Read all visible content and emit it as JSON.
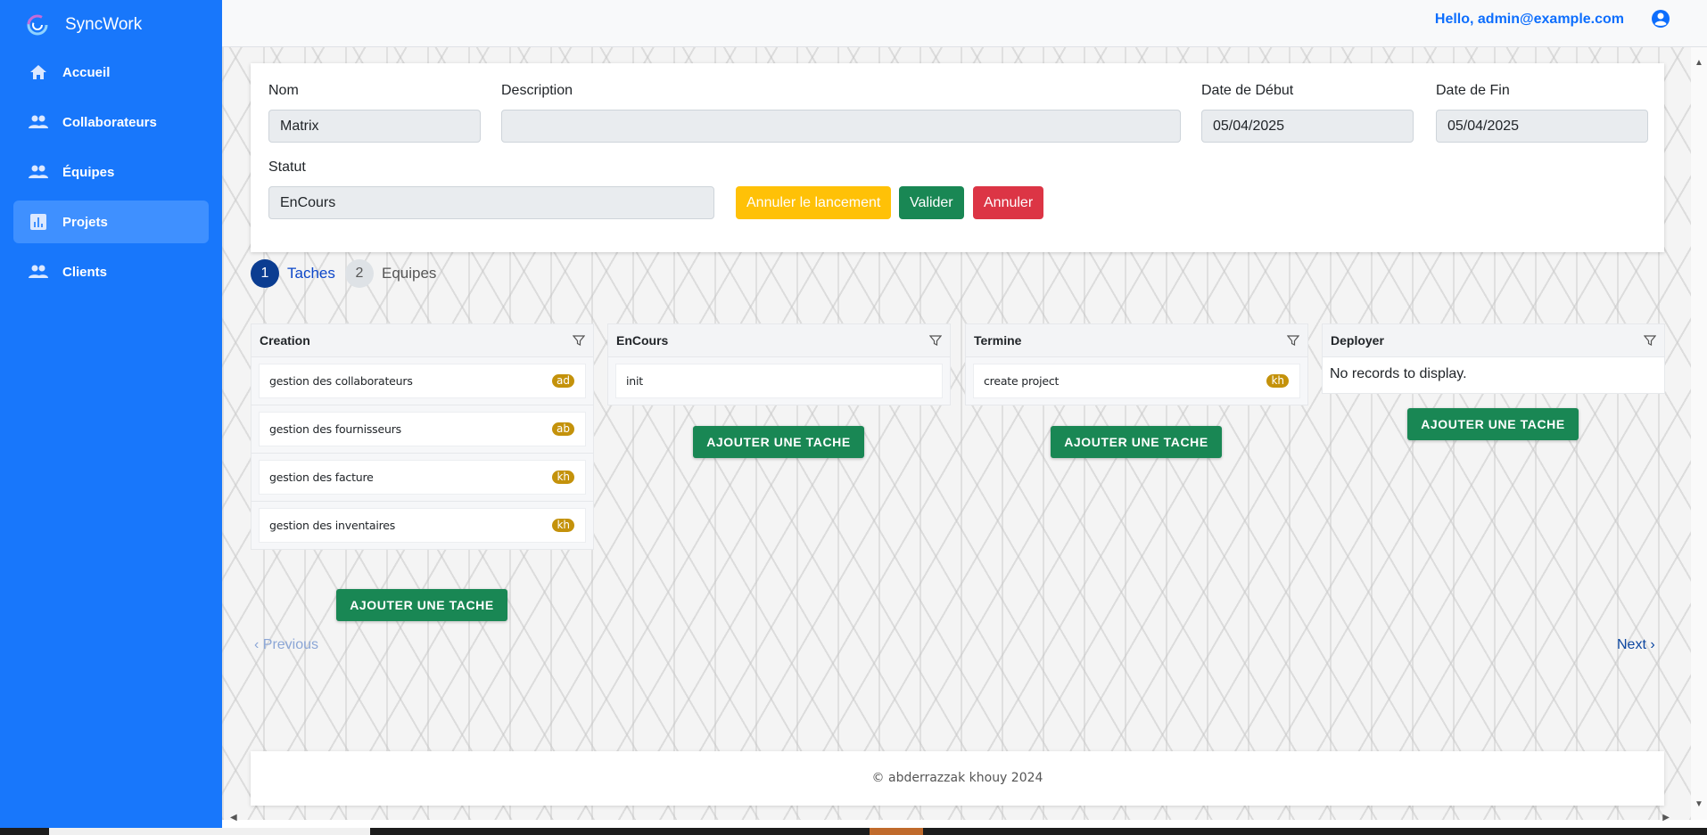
{
  "app": {
    "name": "SyncWork"
  },
  "sidebar": {
    "items": [
      {
        "label": "Accueil",
        "icon": "home-icon"
      },
      {
        "label": "Collaborateurs",
        "icon": "people-icon"
      },
      {
        "label": "Équipes",
        "icon": "people-icon"
      },
      {
        "label": "Projets",
        "icon": "chart-icon",
        "active": true
      },
      {
        "label": "Clients",
        "icon": "people-icon"
      }
    ]
  },
  "header": {
    "greeting": "Hello, admin@example.com",
    "user_icon": "user-circle-icon"
  },
  "form": {
    "nom_label": "Nom",
    "nom_value": "Matrix",
    "description_label": "Description",
    "description_value": "",
    "date_debut_label": "Date de Début",
    "date_debut_value": "05/04/2025",
    "date_fin_label": "Date de Fin",
    "date_fin_value": "05/04/2025",
    "statut_label": "Statut",
    "statut_value": "EnCours",
    "btn_annuler_lancement": "Annuler le lancement",
    "btn_valider": "Valider",
    "btn_annuler": "Annuler"
  },
  "stepper": [
    {
      "num": "1",
      "label": "Taches",
      "active": true
    },
    {
      "num": "2",
      "label": "Equipes",
      "active": false
    }
  ],
  "kanban": {
    "add_label": "AJOUTER UNE TACHE",
    "columns": [
      {
        "title": "Creation",
        "cards": [
          {
            "title": "gestion des collaborateurs",
            "badge": "ad"
          },
          {
            "title": "gestion des fournisseurs",
            "badge": "ab"
          },
          {
            "title": "gestion des facture",
            "badge": "kh"
          },
          {
            "title": "gestion des inventaires",
            "badge": "kh"
          }
        ]
      },
      {
        "title": "EnCours",
        "cards": [
          {
            "title": "init",
            "badge": ""
          }
        ]
      },
      {
        "title": "Termine",
        "cards": [
          {
            "title": "create project",
            "badge": "kh"
          }
        ]
      },
      {
        "title": "Deployer",
        "cards": [],
        "empty": "No records to display."
      }
    ]
  },
  "pager": {
    "previous": "Previous",
    "next": "Next"
  },
  "footer": {
    "text": "© abderrazzak khouy 2024"
  },
  "colors": {
    "sidebar": "#1877fb",
    "primary": "#0d6efd",
    "success": "#198754",
    "warning": "#ffc107",
    "danger": "#dc3545",
    "badge": "#c4920b"
  }
}
